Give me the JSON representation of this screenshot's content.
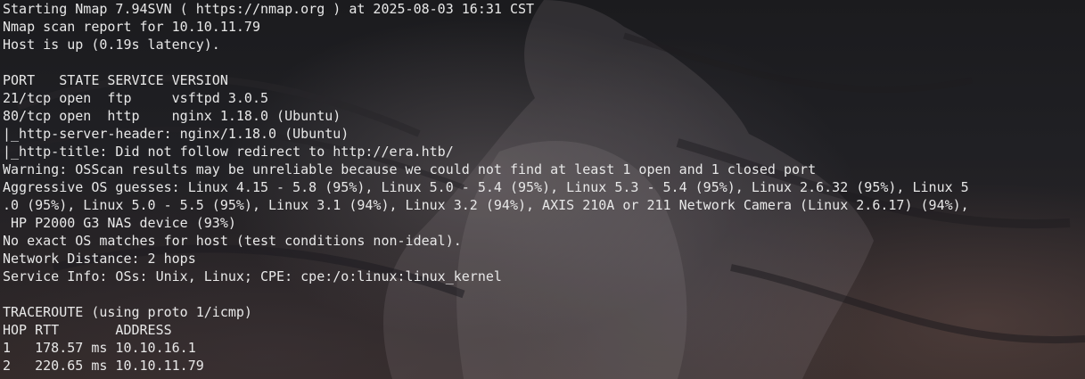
{
  "terminal": {
    "lines": [
      "Starting Nmap 7.94SVN ( https://nmap.org ) at 2025-08-03 16:31 CST",
      "Nmap scan report for 10.10.11.79",
      "Host is up (0.19s latency).",
      "",
      "PORT   STATE SERVICE VERSION",
      "21/tcp open  ftp     vsftpd 3.0.5",
      "80/tcp open  http    nginx 1.18.0 (Ubuntu)",
      "|_http-server-header: nginx/1.18.0 (Ubuntu)",
      "|_http-title: Did not follow redirect to http://era.htb/",
      "Warning: OSScan results may be unreliable because we could not find at least 1 open and 1 closed port",
      "Aggressive OS guesses: Linux 4.15 - 5.8 (95%), Linux 5.0 - 5.4 (95%), Linux 5.3 - 5.4 (95%), Linux 2.6.32 (95%), Linux 5",
      ".0 (95%), Linux 5.0 - 5.5 (95%), Linux 3.1 (94%), Linux 3.2 (94%), AXIS 210A or 211 Network Camera (Linux 2.6.17) (94%),",
      " HP P2000 G3 NAS device (93%)",
      "No exact OS matches for host (test conditions non-ideal).",
      "Network Distance: 2 hops",
      "Service Info: OSs: Unix, Linux; CPE: cpe:/o:linux:linux_kernel",
      "",
      "TRACEROUTE (using proto 1/icmp)",
      "HOP RTT       ADDRESS",
      "1   178.57 ms 10.10.16.1",
      "2   220.65 ms 10.10.11.79"
    ]
  }
}
